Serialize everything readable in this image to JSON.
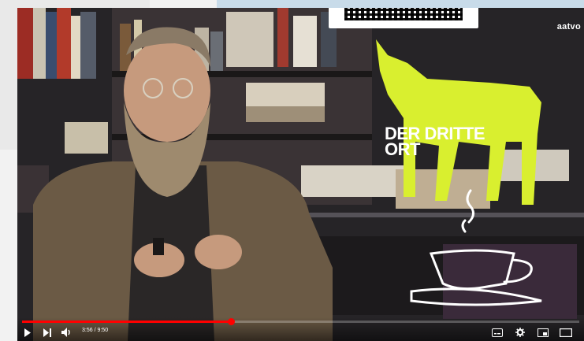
{
  "video": {
    "overlay_title_line1": "DER DRITTE",
    "overlay_title_line2": "ORT",
    "brand_text": "aatvo",
    "progress": 0.375,
    "time_display": "3:56 / 9:50"
  },
  "controls": {
    "icons": [
      "play-icon",
      "next-icon",
      "volume-icon",
      "subtitles-icon",
      "settings-icon",
      "miniplayer-icon",
      "theater-icon"
    ]
  },
  "colors": {
    "progress": "#ff0000",
    "goat": "#d9ef2f",
    "overlay_text": "#ffffff"
  }
}
